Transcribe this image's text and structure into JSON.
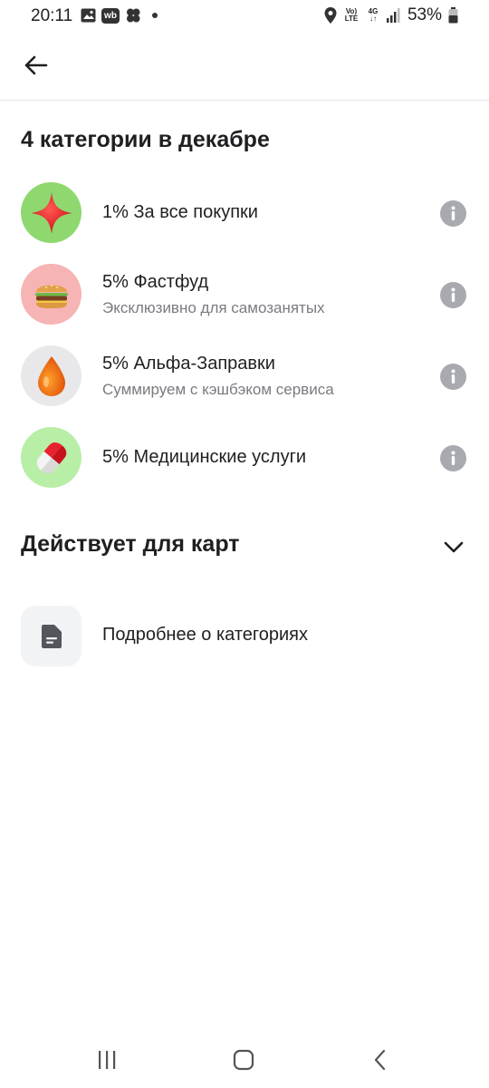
{
  "status_bar": {
    "time": "20:11",
    "volte_top": "Vo)",
    "volte_bottom": "LTE",
    "network_top": "4G",
    "network_bottom": "↓↑",
    "battery": "53%",
    "icons_left": [
      "gallery-icon",
      "wb-app-icon",
      "flower-app-icon",
      "dot-indicator-icon"
    ],
    "icons_right": [
      "location-icon",
      "volte-icon",
      "4g-icon",
      "signal-icon",
      "battery-icon"
    ],
    "wb_label": "wb"
  },
  "header": {
    "back_icon": "arrow-left-icon"
  },
  "categories_section": {
    "title": "4 категории в декабре",
    "items": [
      {
        "title": "1% За все покупки",
        "subtitle": "",
        "icon": "red-star-icon",
        "bg": "#8fd870"
      },
      {
        "title": "5% Фастфуд",
        "subtitle": "Эксклюзивно для самозанятых",
        "icon": "burger-icon",
        "bg": "#f6b4b4"
      },
      {
        "title": "5% Альфа-Заправки",
        "subtitle": "Суммируем с кэшбэком сервиса",
        "icon": "fuel-drop-icon",
        "bg": "#e8e8ea"
      },
      {
        "title": "5% Медицинские услуги",
        "subtitle": "",
        "icon": "pill-icon",
        "bg": "#b8eea6"
      }
    ]
  },
  "cards_section": {
    "title": "Действует для карт",
    "icon": "chevron-down-icon"
  },
  "more": {
    "label": "Подробнее о категориях",
    "icon": "document-icon"
  },
  "colors": {
    "info_button": "#a9aab0",
    "text_primary": "#1f1f22",
    "text_secondary": "#7a7a80"
  },
  "nav_bar": {
    "icons": [
      "recents-icon",
      "home-icon",
      "back-icon"
    ]
  }
}
